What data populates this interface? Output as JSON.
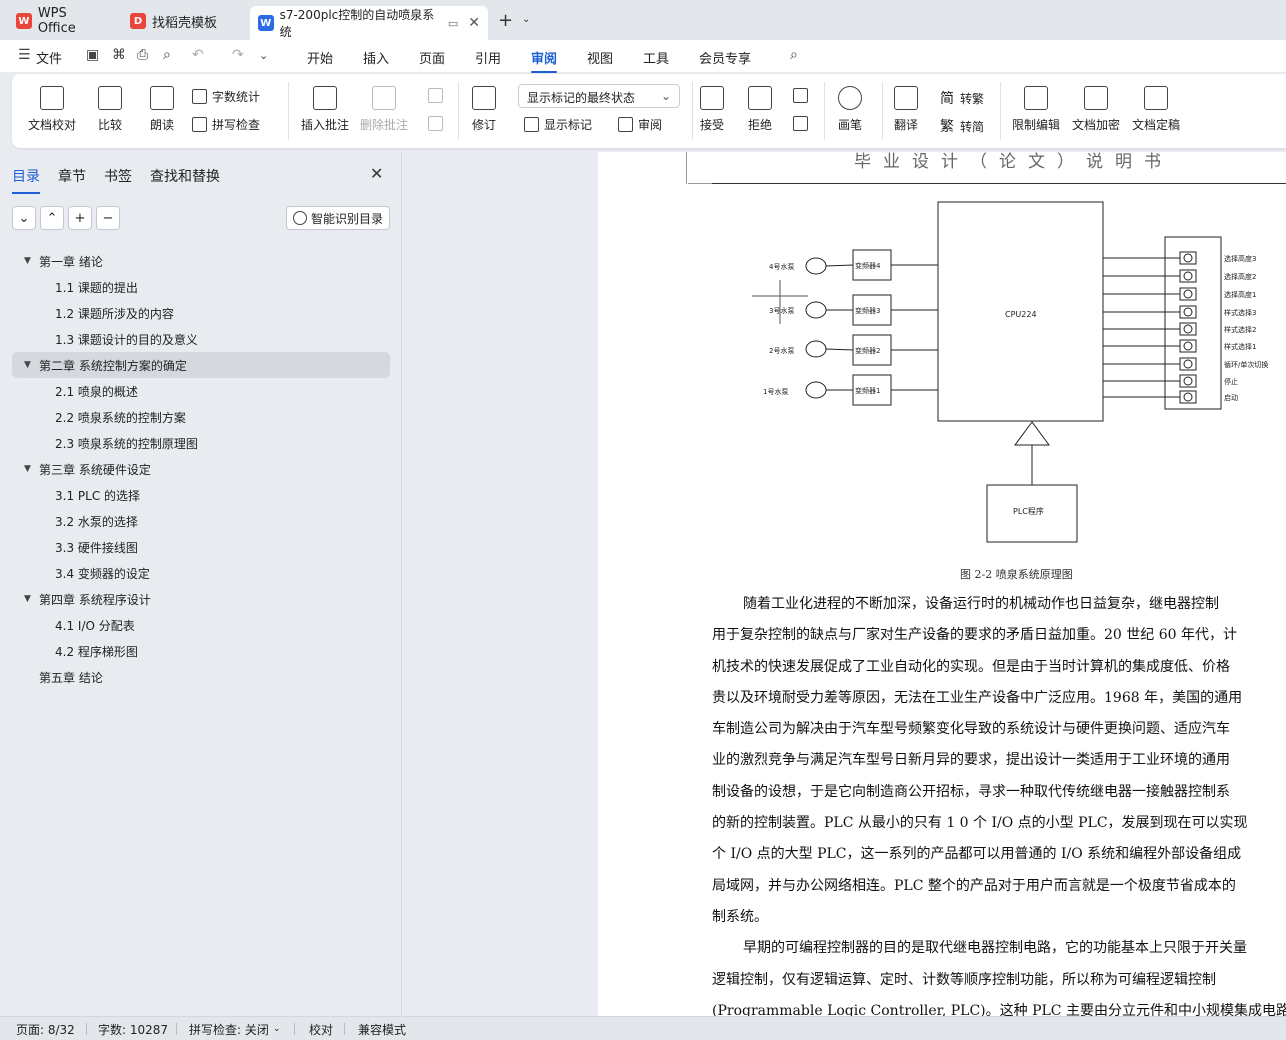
{
  "tabs": {
    "wps": "WPS Office",
    "daoke": "找稻壳模板",
    "doc": "s7-200plc控制的自动喷泉系统"
  },
  "menu": {
    "file": "文件",
    "items": [
      "开始",
      "插入",
      "页面",
      "引用",
      "审阅",
      "视图",
      "工具",
      "会员专享"
    ]
  },
  "ribbon": {
    "doc_check": "文档校对",
    "compare": "比较",
    "read_aloud": "朗读",
    "word_count": "字数统计",
    "spell_check": "拼写检查",
    "insert_comment": "插入批注",
    "delete_comment": "删除批注",
    "track": "修订",
    "markup_dropdown": "显示标记的最终状态",
    "show_markup": "显示标记",
    "review_pane": "审阅",
    "accept": "接受",
    "reject": "拒绝",
    "draw": "画笔",
    "translate": "翻译",
    "to_traditional": "转繁",
    "to_simplified": "转简",
    "simp_label": "简",
    "trad_label": "繁",
    "restrict_edit": "限制编辑",
    "encrypt": "文档加密",
    "finalize": "文档定稿"
  },
  "sidebar": {
    "tabs": [
      "目录",
      "章节",
      "书签",
      "查找和替换"
    ],
    "smart_toc": "智能识别目录",
    "toc": [
      {
        "text": "第一章  绪论",
        "level": 1,
        "expand": true
      },
      {
        "text": "1.1 课题的提出",
        "level": 2
      },
      {
        "text": "1.2  课题所涉及的内容",
        "level": 2
      },
      {
        "text": "1.3  课题设计的目的及意义",
        "level": 2
      },
      {
        "text": "第二章  系统控制方案的确定",
        "level": 1,
        "expand": true,
        "selected": true
      },
      {
        "text": "2.1  喷泉的概述",
        "level": 2
      },
      {
        "text": "2.2  喷泉系统的控制方案",
        "level": 2
      },
      {
        "text": "2.3  喷泉系统的控制原理图",
        "level": 2
      },
      {
        "text": "第三章  系统硬件设定",
        "level": 1,
        "expand": true
      },
      {
        "text": "3.1 PLC 的选择",
        "level": 2
      },
      {
        "text": "3.2 水泵的选择",
        "level": 2
      },
      {
        "text": "3.3   硬件接线图",
        "level": 2
      },
      {
        "text": "3.4  变频器的设定",
        "level": 2
      },
      {
        "text": "第四章  系统程序设计",
        "level": 1,
        "expand": true
      },
      {
        "text": "4.1 I/O 分配表",
        "level": 2
      },
      {
        "text": "4.2 程序梯形图",
        "level": 2
      },
      {
        "text": "第五章  结论",
        "level": 1,
        "expand": false
      }
    ]
  },
  "document": {
    "header": "毕业设计（论文）说明书",
    "diagram": {
      "cpu": "CPU224",
      "plc": "PLC程序",
      "pumps": [
        "4号水泵",
        "3号水泵",
        "2号水泵",
        "1号水泵"
      ],
      "inverters": [
        "变频器4",
        "变频器3",
        "变频器2",
        "变频器1"
      ],
      "inputs": [
        "选择高度3",
        "选择高度2",
        "选择高度1",
        "样式选择3",
        "样式选择2",
        "样式选择1",
        "循环/单次切换",
        "停止",
        "启动"
      ]
    },
    "caption": "图 2-2  喷泉系统原理图",
    "paragraphs": [
      "随着工业化进程的不断加深，设备运行时的机械动作也日益复杂，继电器控制",
      "用于复杂控制的缺点与厂家对生产设备的要求的矛盾日益加重。20 世纪 60 年代，计",
      "机技术的快速发展促成了工业自动化的实现。但是由于当时计算机的集成度低、价格",
      "贵以及环境耐受力差等原因，无法在工业生产设备中广泛应用。1968 年，美国的通用",
      "车制造公司为解决由于汽车型号频繁变化导致的系统设计与硬件更换问题、适应汽车",
      "业的激烈竞争与满足汽车型号日新月异的要求，提出设计一类适用于工业环境的通用",
      "制设备的设想，于是它向制造商公开招标，寻求一种取代传统继电器一接触器控制系",
      "的新的控制装置。PLC 从最小的只有 1 0 个 I/O 点的小型 PLC，发展到现在可以实现",
      "个 I/O 点的大型 PLC，这一系列的产品都可以用普通的 I/O 系统和编程外部设备组成",
      "局域网，并与办公网络相连。PLC 整个的产品对于用户而言就是一个极度节省成本的",
      "制系统。",
      "早期的可编程控制器的目的是取代继电器控制电路，它的功能基本上只限于开关量",
      "逻辑控制，仅有逻辑运算、定时、计数等顺序控制功能，所以称为可编程逻辑控制",
      "(Programmable Logic Controller, PLC)。这种 PLC 主要由分立元件和中小规模集成电路"
    ]
  },
  "status": {
    "page": "页面: 8/32",
    "words": "字数: 10287",
    "spell": "拼写检查: 关闭",
    "proof": "校对",
    "compat": "兼容模式"
  }
}
